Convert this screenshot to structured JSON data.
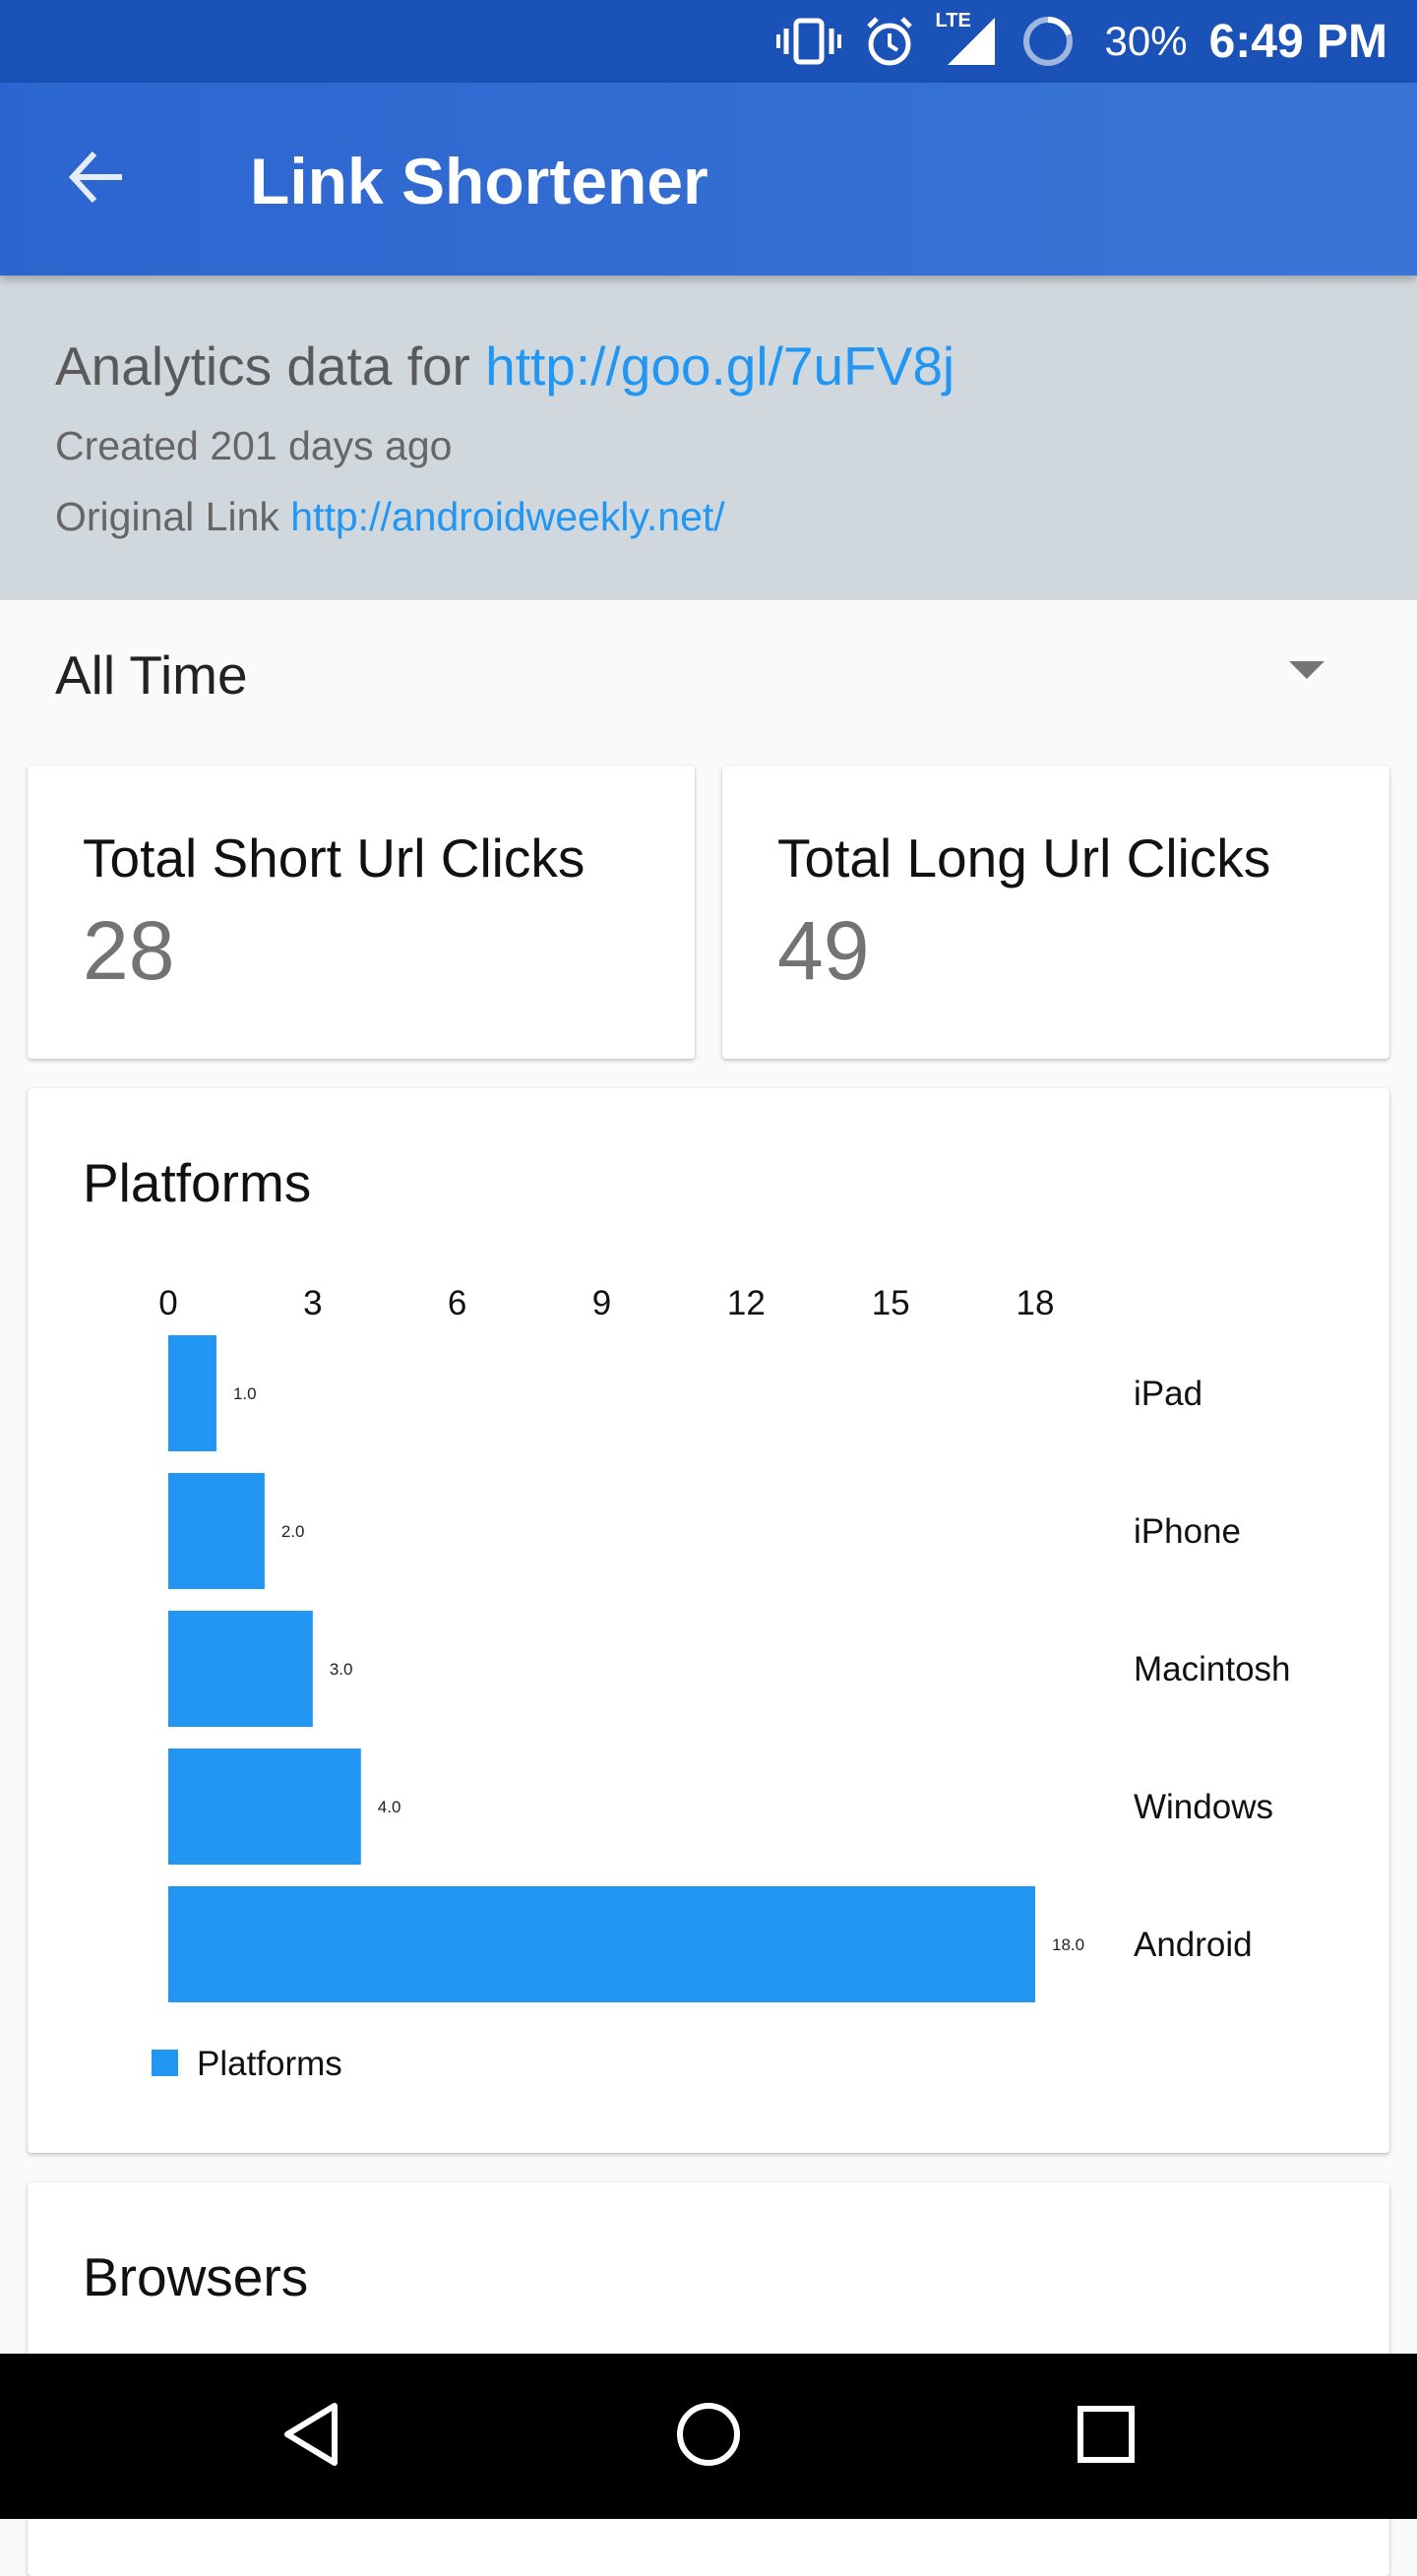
{
  "status_bar": {
    "battery": "30%",
    "time": "6:49 PM",
    "network_label": "LTE",
    "icons": [
      "vibrate-icon",
      "alarm-icon",
      "signal-icon",
      "battery-icon"
    ]
  },
  "app_bar": {
    "title": "Link Shortener",
    "back_icon": "arrow-back-icon"
  },
  "info": {
    "title_prefix": "Analytics data for",
    "short_url": "http://goo.gl/7uFV8j",
    "created": "Created 201 days ago",
    "original_label": "Original Link",
    "original_url": "http://androidweekly.net/"
  },
  "range": {
    "selected": "All Time"
  },
  "stats": {
    "short": {
      "label": "Total Short Url Clicks",
      "value": "28"
    },
    "long": {
      "label": "Total Long Url Clicks",
      "value": "49"
    }
  },
  "platforms_title": "Platforms",
  "browsers_title": "Browsers",
  "colors": {
    "primary": "#3a75d6",
    "status": "#1a52b8",
    "accent": "#2196f3",
    "bar": "#2196f3"
  },
  "chart_data": {
    "type": "bar",
    "orientation": "horizontal",
    "categories": [
      "iPad",
      "iPhone",
      "Macintosh",
      "Windows",
      "Android"
    ],
    "series": [
      {
        "name": "Platforms",
        "values": [
          1.0,
          2.0,
          3.0,
          4.0,
          18.0
        ]
      }
    ],
    "value_labels": [
      "1.0",
      "2.0",
      "3.0",
      "4.0",
      "18.0"
    ],
    "xticks": [
      "0",
      "3",
      "6",
      "9",
      "12",
      "15",
      "18"
    ],
    "xlim": [
      0,
      18
    ],
    "axis_position": "top",
    "legend": "bottom-left",
    "grid": false
  },
  "nav_bar": {
    "icons": [
      "back-triangle-icon",
      "home-circle-icon",
      "recents-square-icon"
    ]
  }
}
